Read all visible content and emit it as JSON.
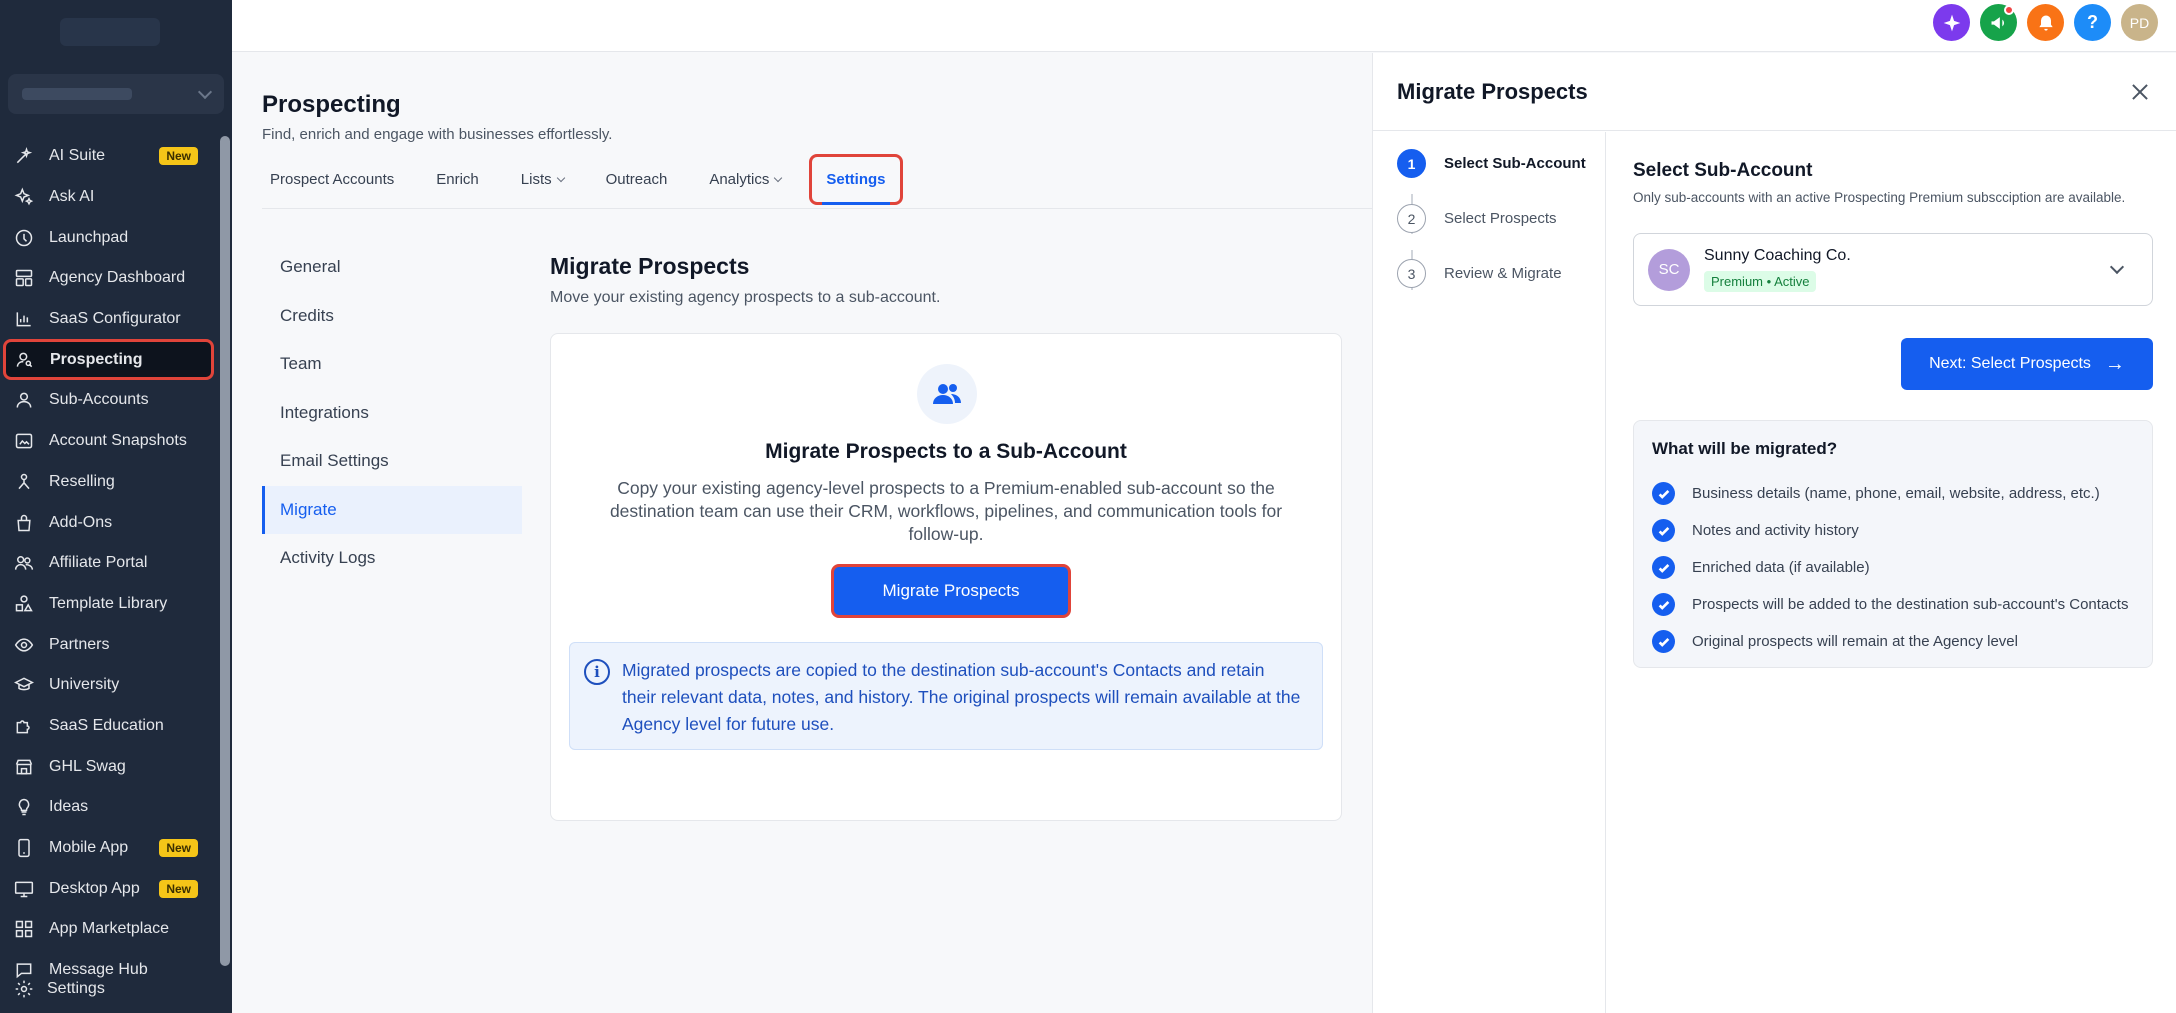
{
  "sidebar": {
    "items": [
      {
        "label": "AI Suite",
        "icon": "sparkle-wand-icon",
        "badge": "New"
      },
      {
        "label": "Ask AI",
        "icon": "sparkles-icon"
      },
      {
        "label": "Launchpad",
        "icon": "rocket-icon"
      },
      {
        "label": "Agency Dashboard",
        "icon": "dashboard-icon"
      },
      {
        "label": "SaaS Configurator",
        "icon": "chart-bars-icon"
      },
      {
        "label": "Prospecting",
        "icon": "user-search-icon",
        "active": true
      },
      {
        "label": "Sub-Accounts",
        "icon": "user-icon"
      },
      {
        "label": "Account Snapshots",
        "icon": "snapshot-icon"
      },
      {
        "label": "Reselling",
        "icon": "reselling-icon"
      },
      {
        "label": "Add-Ons",
        "icon": "bag-icon"
      },
      {
        "label": "Affiliate Portal",
        "icon": "users-icon"
      },
      {
        "label": "Template Library",
        "icon": "shapes-icon"
      },
      {
        "label": "Partners",
        "icon": "eye-icon"
      },
      {
        "label": "University",
        "icon": "graduation-cap-icon"
      },
      {
        "label": "SaaS Education",
        "icon": "puzzle-icon"
      },
      {
        "label": "GHL Swag",
        "icon": "store-icon"
      },
      {
        "label": "Ideas",
        "icon": "lightbulb-icon"
      },
      {
        "label": "Mobile App",
        "icon": "phone-icon",
        "badge": "New"
      },
      {
        "label": "Desktop App",
        "icon": "monitor-icon",
        "badge": "New"
      },
      {
        "label": "App Marketplace",
        "icon": "grid-icon"
      },
      {
        "label": "Message Hub",
        "icon": "chat-icon"
      }
    ],
    "settings_label": "Settings"
  },
  "topbar": {
    "icons": [
      {
        "name": "ai-sparkle-icon",
        "color": "#7c3aed"
      },
      {
        "name": "megaphone-icon",
        "color": "#16a34a"
      },
      {
        "name": "bell-icon",
        "color": "#f97316"
      },
      {
        "name": "help-icon",
        "color": "#1d8cf8",
        "text": "?"
      },
      {
        "name": "avatar",
        "color": "#c9b48a",
        "text": "PD"
      }
    ]
  },
  "page": {
    "title": "Prospecting",
    "subtitle": "Find, enrich and engage with businesses effortlessly.",
    "tabs": [
      {
        "label": "Prospect Accounts"
      },
      {
        "label": "Enrich"
      },
      {
        "label": "Lists",
        "dropdown": true
      },
      {
        "label": "Outreach"
      },
      {
        "label": "Analytics",
        "dropdown": true
      },
      {
        "label": "Settings",
        "active": true
      }
    ]
  },
  "settings_nav": {
    "items": [
      {
        "label": "General"
      },
      {
        "label": "Credits"
      },
      {
        "label": "Team"
      },
      {
        "label": "Integrations"
      },
      {
        "label": "Email Settings"
      },
      {
        "label": "Migrate",
        "active": true
      },
      {
        "label": "Activity Logs"
      }
    ]
  },
  "migrate_section": {
    "title": "Migrate Prospects",
    "subtitle": "Move your existing agency prospects to a sub-account.",
    "card_title": "Migrate Prospects to a Sub-Account",
    "card_desc": "Copy your existing agency-level prospects to a Premium-enabled sub-account so the destination team can use their CRM, workflows, pipelines, and communication tools for follow-up.",
    "button_label": "Migrate Prospects",
    "info_text": "Migrated prospects are copied to the destination sub-account's Contacts and retain their relevant data, notes, and history. The original prospects will remain available at the Agency level for future use."
  },
  "drawer": {
    "title": "Migrate Prospects",
    "steps": [
      {
        "num": "1",
        "label": "Select Sub-Account",
        "current": true
      },
      {
        "num": "2",
        "label": "Select Prospects"
      },
      {
        "num": "3",
        "label": "Review & Migrate"
      }
    ],
    "section_title": "Select Sub-Account",
    "section_sub": "Only sub-accounts with an active Prospecting Premium subscciption are available.",
    "selected": {
      "initials": "SC",
      "name": "Sunny Coaching Co.",
      "badge": "Premium • Active"
    },
    "next_label": "Next: Select Prospects",
    "migrated_title": "What will be migrated?",
    "migrated_items": [
      "Business details (name, phone, email, website, address, etc.)",
      "Notes and activity history",
      "Enriched data (if available)",
      "Prospects will be added to the destination sub-account's Contacts",
      "Original prospects will remain at the Agency level"
    ]
  }
}
